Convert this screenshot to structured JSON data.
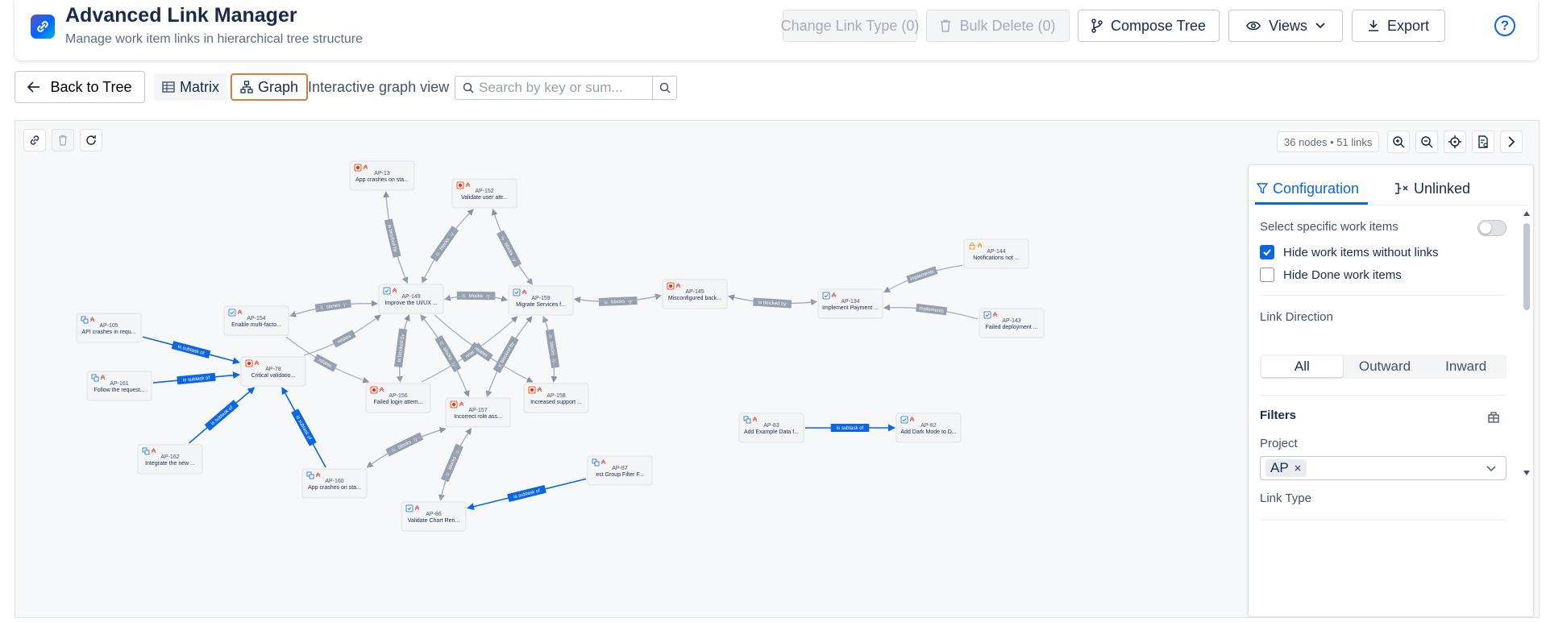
{
  "header": {
    "title": "Advanced Link Manager",
    "subtitle": "Manage work item links in hierarchical tree structure",
    "change_link_type": "Change Link Type (0)",
    "bulk_delete": "Bulk Delete (0)",
    "compose_tree": "Compose Tree",
    "views": "Views",
    "export": "Export",
    "help": "?"
  },
  "toolbar": {
    "back": "Back to Tree",
    "matrix": "Matrix",
    "graph": "Graph",
    "description": "Interactive graph view",
    "search_placeholder": "Search by key or sum..."
  },
  "graph": {
    "count": "36 nodes • 51 links",
    "nodes": [
      {
        "id": "AP-13",
        "summary": "App crashes on sta...",
        "type": "bug",
        "icon": "bug-icon"
      },
      {
        "id": "AP-152",
        "summary": "Validate user attr...",
        "type": "bug",
        "icon": "bug-icon"
      },
      {
        "id": "AP-149",
        "summary": "Improve the UI/UX ...",
        "type": "task",
        "icon": "task-icon"
      },
      {
        "id": "AP-159",
        "summary": "Migrate Services f...",
        "type": "task",
        "icon": "task-icon"
      },
      {
        "id": "AP-154",
        "summary": "Enable multi-facto...",
        "type": "task",
        "icon": "task-icon"
      },
      {
        "id": "AP-145",
        "summary": "Misconfigured back...",
        "type": "bug",
        "icon": "bug-icon"
      },
      {
        "id": "AP-134",
        "summary": "Implement Payment ...",
        "type": "task",
        "icon": "task-icon"
      },
      {
        "id": "AP-144",
        "summary": "Notifications not ...",
        "type": "lock",
        "icon": "lock-icon"
      },
      {
        "id": "AP-143",
        "summary": "Failed deployment ...",
        "type": "task",
        "icon": "task-icon"
      },
      {
        "id": "AP-105",
        "summary": "API crashes in requ...",
        "type": "subtask",
        "icon": "subtask-icon"
      },
      {
        "id": "AP-78",
        "summary": "Critical validatio...",
        "type": "bug",
        "icon": "bug-icon"
      },
      {
        "id": "AP-161",
        "summary": "Follow the request...",
        "type": "subtask",
        "icon": "subtask-icon"
      },
      {
        "id": "AP-156",
        "summary": "Failed login attem...",
        "type": "bug",
        "icon": "bug-icon"
      },
      {
        "id": "AP-158",
        "summary": "Increased support ...",
        "type": "bug",
        "icon": "bug-icon"
      },
      {
        "id": "AP-157",
        "summary": "Incorrect role ass...",
        "type": "bug",
        "icon": "bug-icon"
      },
      {
        "id": "AP-162",
        "summary": "Integrate the new ...",
        "type": "subtask",
        "icon": "subtask-icon"
      },
      {
        "id": "AP-160",
        "summary": "App crashes on sta...",
        "type": "subtask",
        "icon": "subtask-icon"
      },
      {
        "id": "AP-86",
        "summary": "Validate Chart Ren...",
        "type": "task",
        "icon": "task-icon"
      },
      {
        "id": "AP-87",
        "summary": "est Group Filter F...",
        "type": "subtask",
        "icon": "subtask-icon"
      },
      {
        "id": "AP-83",
        "summary": "Add Example Data f...",
        "type": "subtask",
        "icon": "subtask-icon"
      },
      {
        "id": "AP-82",
        "summary": "Add Dark Mode to D...",
        "type": "task",
        "icon": "task-icon"
      }
    ],
    "links": [
      {
        "from": "AP-13",
        "to": "AP-149",
        "label": "blocks",
        "kind": "gray"
      },
      {
        "from": "AP-149",
        "to": "AP-13",
        "label": "is blocked by",
        "kind": "gray"
      },
      {
        "from": "AP-152",
        "to": "AP-149",
        "label": "is blocked by",
        "kind": "gray"
      },
      {
        "from": "AP-149",
        "to": "AP-152",
        "label": "blocks",
        "kind": "gray"
      },
      {
        "from": "AP-152",
        "to": "AP-159",
        "label": "is blocked by",
        "kind": "gray"
      },
      {
        "from": "AP-159",
        "to": "AP-152",
        "label": "blocks",
        "kind": "gray"
      },
      {
        "from": "AP-159",
        "to": "AP-149",
        "label": "is blocked by",
        "kind": "gray"
      },
      {
        "from": "AP-149",
        "to": "AP-159",
        "label": "blocks",
        "kind": "gray"
      },
      {
        "from": "AP-149",
        "to": "AP-154",
        "label": "is cloned by",
        "kind": "gray"
      },
      {
        "from": "AP-154",
        "to": "AP-149",
        "label": "clones",
        "kind": "gray"
      },
      {
        "from": "AP-159",
        "to": "AP-145",
        "label": "is blocked by",
        "kind": "gray"
      },
      {
        "from": "AP-145",
        "to": "AP-159",
        "label": "blocks",
        "kind": "gray"
      },
      {
        "from": "AP-145",
        "to": "AP-134",
        "label": "blocks",
        "kind": "gray"
      },
      {
        "from": "AP-134",
        "to": "AP-145",
        "label": "is blocked by",
        "kind": "gray"
      },
      {
        "from": "AP-144",
        "to": "AP-134",
        "label": "implements",
        "kind": "gray"
      },
      {
        "from": "AP-143",
        "to": "AP-134",
        "label": "implements",
        "kind": "gray"
      },
      {
        "from": "AP-105",
        "to": "AP-78",
        "label": "is subtask of",
        "kind": "blue"
      },
      {
        "from": "AP-161",
        "to": "AP-78",
        "label": "is subtask of",
        "kind": "blue"
      },
      {
        "from": "AP-162",
        "to": "AP-78",
        "label": "is subtask of",
        "kind": "blue"
      },
      {
        "from": "AP-160",
        "to": "AP-78",
        "label": "is subtask of",
        "kind": "blue"
      },
      {
        "from": "AP-87",
        "to": "AP-86",
        "label": "is subtask of",
        "kind": "blue"
      },
      {
        "from": "AP-83",
        "to": "AP-82",
        "label": "is subtask of",
        "kind": "blue"
      },
      {
        "from": "AP-78",
        "to": "AP-149",
        "label": "relates",
        "kind": "gray"
      },
      {
        "from": "AP-154",
        "to": "AP-156",
        "label": "relates",
        "kind": "gray"
      },
      {
        "from": "AP-156",
        "to": "AP-159",
        "label": "relates",
        "kind": "gray"
      },
      {
        "from": "AP-149",
        "to": "AP-156",
        "label": "blocks",
        "kind": "gray"
      },
      {
        "from": "AP-156",
        "to": "AP-149",
        "label": "is blocked by",
        "kind": "gray"
      },
      {
        "from": "AP-157",
        "to": "AP-149",
        "label": "is blocked by",
        "kind": "gray"
      },
      {
        "from": "AP-149",
        "to": "AP-157",
        "label": "blocks",
        "kind": "gray"
      },
      {
        "from": "AP-159",
        "to": "AP-157",
        "label": "blocks",
        "kind": "gray"
      },
      {
        "from": "AP-157",
        "to": "AP-159",
        "label": "is blocked by",
        "kind": "gray"
      },
      {
        "from": "AP-158",
        "to": "AP-159",
        "label": "is blocked by",
        "kind": "gray"
      },
      {
        "from": "AP-159",
        "to": "AP-158",
        "label": "blocks",
        "kind": "gray"
      },
      {
        "from": "AP-149",
        "to": "AP-158",
        "label": "relates",
        "kind": "gray"
      },
      {
        "from": "AP-157",
        "to": "AP-160",
        "label": "is blocked by",
        "kind": "gray"
      },
      {
        "from": "AP-160",
        "to": "AP-157",
        "label": "blocks",
        "kind": "gray"
      },
      {
        "from": "AP-157",
        "to": "AP-86",
        "label": "is blocked by",
        "kind": "gray"
      },
      {
        "from": "AP-86",
        "to": "AP-157",
        "label": "blocks",
        "kind": "gray"
      }
    ]
  },
  "panel": {
    "tab_config": "Configuration",
    "tab_unlinked": "Unlinked",
    "select_specific": "Select specific work items",
    "hide_without_links": "Hide work items without links",
    "hide_done": "Hide Done work items",
    "link_direction": "Link Direction",
    "dir_all": "All",
    "dir_outward": "Outward",
    "dir_inward": "Inward",
    "filters": "Filters",
    "project": "Project",
    "project_value": "AP",
    "link_type": "Link Type"
  }
}
